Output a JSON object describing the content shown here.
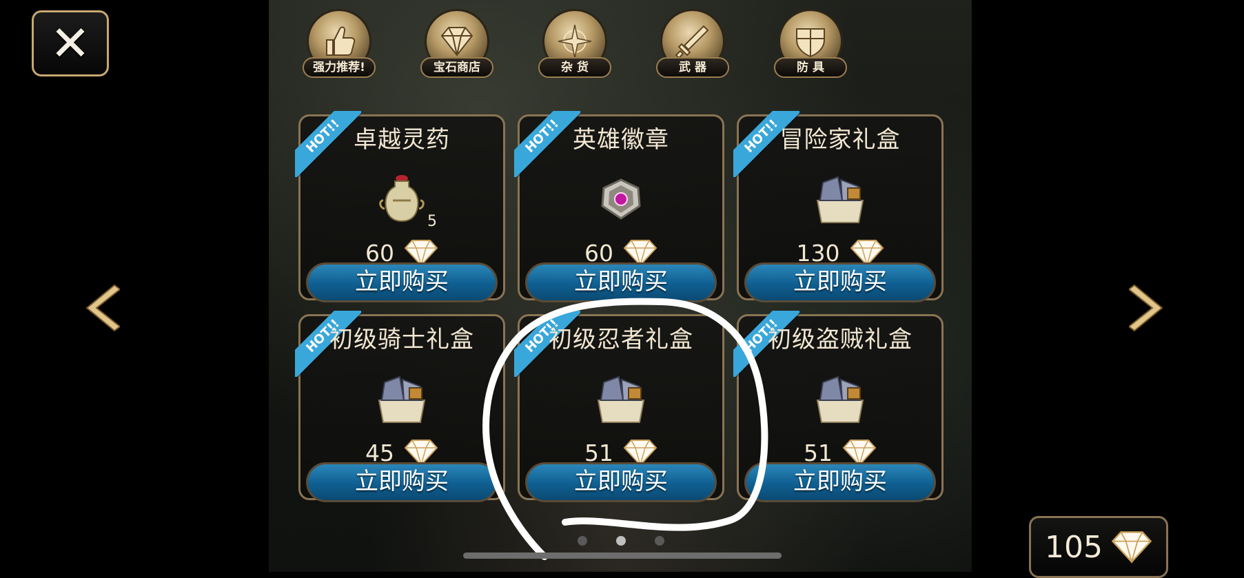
{
  "close_button": {
    "glyph": "✕"
  },
  "nav": {
    "prev_glyph": "‹",
    "next_glyph": "›"
  },
  "tabs": [
    {
      "label": "强力推荐!",
      "icon": "thumbs-up-icon"
    },
    {
      "label": "宝石商店",
      "icon": "gem-icon"
    },
    {
      "label": "杂 货",
      "icon": "compass-icon"
    },
    {
      "label": "武 器",
      "icon": "sword-icon"
    },
    {
      "label": "防 具",
      "icon": "shield-icon"
    }
  ],
  "items": [
    {
      "name": "卓越灵药",
      "price": "60",
      "qty": "5",
      "hot": "HOT!!",
      "buy": "立即购买",
      "icon": "elixir-jar-icon"
    },
    {
      "name": "英雄徽章",
      "price": "60",
      "qty": "",
      "hot": "HOT!!",
      "buy": "立即购买",
      "icon": "hero-badge-icon"
    },
    {
      "name": "冒险家礼盒",
      "price": "130",
      "qty": "",
      "hot": "HOT!!",
      "buy": "立即购买",
      "icon": "gift-box-icon"
    },
    {
      "name": "初级骑士礼盒",
      "price": "45",
      "qty": "",
      "hot": "HOT!!",
      "buy": "立即购买",
      "icon": "gift-box-icon"
    },
    {
      "name": "初级忍者礼盒",
      "price": "51",
      "qty": "",
      "hot": "HOT!!",
      "buy": "立即购买",
      "icon": "gift-box-icon"
    },
    {
      "name": "初级盗贼礼盒",
      "price": "51",
      "qty": "",
      "hot": "HOT!!",
      "buy": "立即购买",
      "icon": "gift-box-icon"
    }
  ],
  "pagination": {
    "current": 2,
    "total": 3
  },
  "balance": {
    "amount": "105",
    "icon": "diamond-icon"
  },
  "colors": {
    "buy_button": "#0f5f91",
    "hot_ribbon": "#39a7da",
    "gold_border": "#c9a871"
  }
}
